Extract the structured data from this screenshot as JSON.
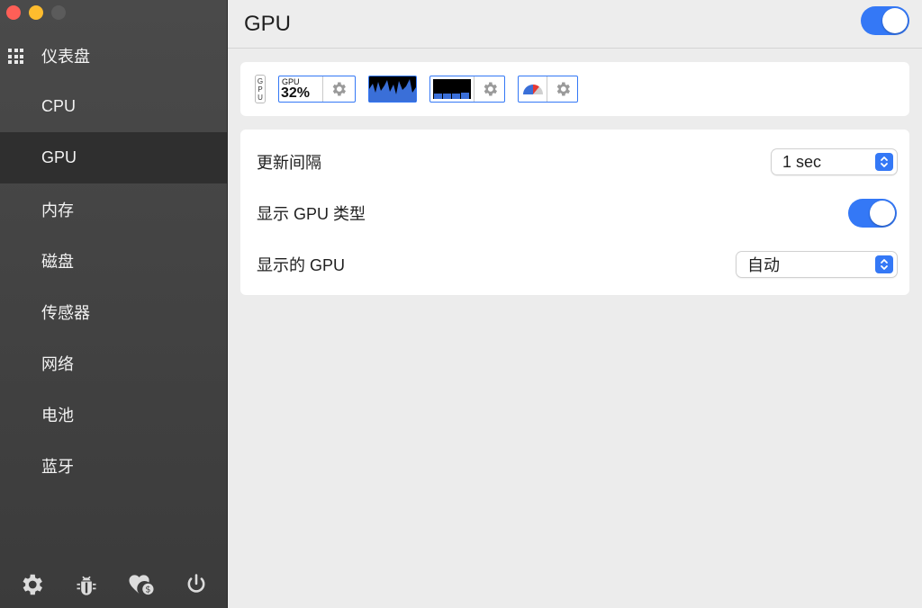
{
  "sidebar": {
    "items": [
      {
        "label": "仪表盘",
        "icon": "grid-icon"
      },
      {
        "label": "CPU"
      },
      {
        "label": "GPU",
        "active": true
      },
      {
        "label": "内存"
      },
      {
        "label": "磁盘"
      },
      {
        "label": "传感器"
      },
      {
        "label": "网络"
      },
      {
        "label": "电池"
      },
      {
        "label": "蓝牙"
      }
    ],
    "footer_icons": [
      "gear-icon",
      "bug-icon",
      "heart-donate-icon",
      "power-icon"
    ]
  },
  "header": {
    "title": "GPU",
    "enabled": true
  },
  "widgets": {
    "label_letters": [
      "G",
      "P",
      "U"
    ],
    "mini": {
      "label": "GPU",
      "value": "32%"
    }
  },
  "settings": {
    "update_interval_label": "更新间隔",
    "update_interval_value": "1 sec",
    "show_gpu_type_label": "显示 GPU 类型",
    "show_gpu_type_enabled": true,
    "displayed_gpu_label": "显示的 GPU",
    "displayed_gpu_value": "自动"
  },
  "colors": {
    "accent": "#3478f6",
    "sidebar_bg": "#434343",
    "active_item_bg": "#2f2f2f"
  }
}
